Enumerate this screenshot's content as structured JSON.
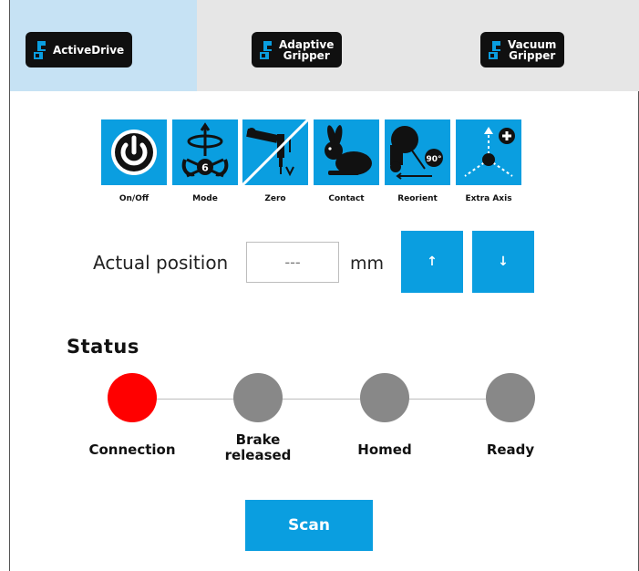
{
  "tabs": [
    {
      "label": "ActiveDrive",
      "active": true
    },
    {
      "label": "Adaptive\nGripper",
      "active": false
    },
    {
      "label": "Vacuum\nGripper",
      "active": false
    }
  ],
  "tools": [
    {
      "label": "On/Off",
      "icon": "power-icon"
    },
    {
      "label": "Mode",
      "icon": "mode-6dof-icon"
    },
    {
      "label": "Zero",
      "icon": "zero-icon"
    },
    {
      "label": "Contact",
      "icon": "rabbit-icon"
    },
    {
      "label": "Reorient",
      "icon": "reorient-90-icon"
    },
    {
      "label": "Extra Axis",
      "icon": "extra-axis-icon"
    }
  ],
  "position": {
    "label": "Actual position",
    "value": "---",
    "unit": "mm",
    "up": "↑",
    "down": "↓"
  },
  "status": {
    "title": "Status",
    "items": [
      {
        "label": "Connection",
        "state": "red"
      },
      {
        "label": "Brake\nreleased",
        "state": "gray"
      },
      {
        "label": "Homed",
        "state": "gray"
      },
      {
        "label": "Ready",
        "state": "gray"
      }
    ],
    "colors": {
      "red": "#ff0000",
      "gray": "#888888"
    }
  },
  "scan": {
    "label": "Scan"
  },
  "colors": {
    "accent": "#0a9ee0",
    "tab_active": "#c6e2f4",
    "tab_bg": "#e6e6e6"
  }
}
